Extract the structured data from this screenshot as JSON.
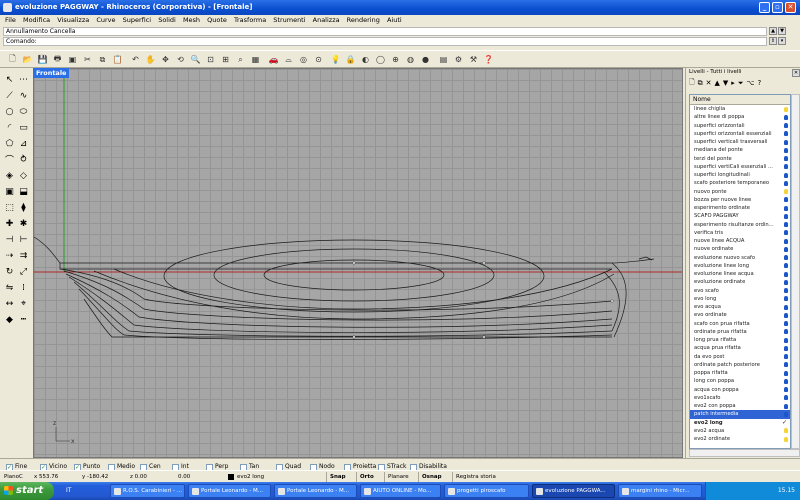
{
  "window": {
    "title": "evoluzione PAGGWAY - Rhinoceros (Corporativa) - [Frontale]"
  },
  "menu": [
    "File",
    "Modifica",
    "Visualizza",
    "Curve",
    "Superfici",
    "Solidi",
    "Mesh",
    "Quote",
    "Trasforma",
    "Strumenti",
    "Analizza",
    "Rendering",
    "Aiuti"
  ],
  "command": {
    "history": "Annullamento Cancella",
    "prompt": "Comando:"
  },
  "viewport": {
    "tab": "Frontale",
    "axis_x": "x",
    "axis_z": "z"
  },
  "layers_panel": {
    "title": "Livelli - Tutti i livelli",
    "header": "Nome",
    "layers": [
      {
        "name": "linee chiglia",
        "on": false
      },
      {
        "name": "altre linee di poppa",
        "on": true
      },
      {
        "name": "superfici orizzontali",
        "on": true
      },
      {
        "name": "superfici orizzontali essenziali",
        "on": true
      },
      {
        "name": "superfici verticali trasversali",
        "on": true
      },
      {
        "name": "mediana del ponte",
        "on": true
      },
      {
        "name": "terzi del ponte",
        "on": true
      },
      {
        "name": "superfici vertiCali essenziali ...",
        "on": true
      },
      {
        "name": "superfici longitudinali",
        "on": true
      },
      {
        "name": "scafo posteriore temporaneo",
        "on": true
      },
      {
        "name": "nuovo ponte",
        "on": false
      },
      {
        "name": "bozza per nuove linee",
        "on": true
      },
      {
        "name": "esperimento ordinate",
        "on": true
      },
      {
        "name": "SCAFO PAGGWAY",
        "on": true
      },
      {
        "name": "esperimento risultanze ordin...",
        "on": true
      },
      {
        "name": "verifica tris",
        "on": true
      },
      {
        "name": "nuove linee ACQUA",
        "on": true
      },
      {
        "name": "nuove ordinate",
        "on": true
      },
      {
        "name": "evoluzione nuovo scafo",
        "on": true
      },
      {
        "name": "evoluzione linee long",
        "on": true
      },
      {
        "name": "evoluzione linee acqua",
        "on": true
      },
      {
        "name": "evoluzione ordinate",
        "on": true
      },
      {
        "name": "evo scafo",
        "on": true
      },
      {
        "name": "evo long",
        "on": true
      },
      {
        "name": "evo acqua",
        "on": true
      },
      {
        "name": "evo ordinate",
        "on": true
      },
      {
        "name": "scafo con prua rifatta",
        "on": true
      },
      {
        "name": "ordinate prua rifatta",
        "on": true
      },
      {
        "name": "long prua rifatta",
        "on": true
      },
      {
        "name": "acqua prua rifatta",
        "on": true
      },
      {
        "name": "da evo post",
        "on": true
      },
      {
        "name": "ordinate patch posteriore",
        "on": true
      },
      {
        "name": "poppa rifatta",
        "on": true
      },
      {
        "name": "long con poppa",
        "on": true
      },
      {
        "name": "acqua con poppa",
        "on": true
      },
      {
        "name": "evo1scafo",
        "on": true
      },
      {
        "name": "evo2 con poppa",
        "on": true
      },
      {
        "name": "patch intermedia",
        "on": true,
        "selected": true
      },
      {
        "name": "evo2 long",
        "on": true,
        "current": true
      },
      {
        "name": "evo2 acqua",
        "on": false
      },
      {
        "name": "evo2 ordinate",
        "on": false
      }
    ]
  },
  "osnap": [
    {
      "label": "Fine",
      "checked": true
    },
    {
      "label": "Vicino",
      "checked": true
    },
    {
      "label": "Punto",
      "checked": true
    },
    {
      "label": "Medio",
      "checked": false
    },
    {
      "label": "Cen",
      "checked": false
    },
    {
      "label": "Int",
      "checked": false
    },
    {
      "label": "Perp",
      "checked": false
    },
    {
      "label": "Tan",
      "checked": false
    },
    {
      "label": "Quad",
      "checked": false
    },
    {
      "label": "Nodo",
      "checked": false
    },
    {
      "label": "Proietta",
      "checked": false
    },
    {
      "label": "STrack",
      "checked": false
    },
    {
      "label": "Disabilita",
      "checked": false
    }
  ],
  "status": {
    "cplane": "PianoC",
    "x": "x 553.76",
    "y": "y -180.42",
    "z": "z 0.00",
    "dist": "0.00",
    "layer": "evo2 long",
    "toggles": [
      "Snap",
      "Orto",
      "Planare",
      "Osnap",
      "Registra storia"
    ]
  },
  "taskbar": {
    "start": "start",
    "lang": "IT",
    "tasks": [
      "R.O.S. Carabinieri - ...",
      "Portale Leonardo - M...",
      "Portale Leonardo - M...",
      "AIUTO ONLINE - Mo...",
      "progetti piroscafo",
      "evoluzione PAGGWA...",
      "margini rhino - Micr..."
    ],
    "active_task": 5,
    "clock": "15.15"
  },
  "colors": {
    "title_blue": "#0b4fd0",
    "grid": "#a6a6a6",
    "x_axis": "#b00000",
    "z_axis": "#00a000",
    "curve": "#1a1a1a"
  }
}
